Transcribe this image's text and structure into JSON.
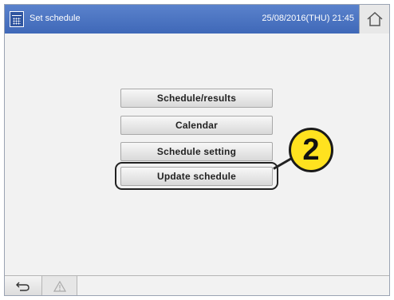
{
  "header": {
    "title": "Set schedule",
    "datetime": "25/08/2016(THU) 21:45",
    "calendar_icon": "calendar-icon",
    "home_icon": "home-icon"
  },
  "menu": {
    "items": [
      {
        "label": "Schedule/results"
      },
      {
        "label": "Calendar"
      },
      {
        "label": "Schedule setting"
      },
      {
        "label": "Update schedule"
      }
    ]
  },
  "annotation": {
    "step_number": "2",
    "badge_color": "#ffe21f"
  },
  "footer": {
    "back_icon": "return-icon",
    "warning_icon": "warning-icon"
  },
  "colors": {
    "title_bar": "#4a74c4",
    "background": "#f2f2f2"
  }
}
